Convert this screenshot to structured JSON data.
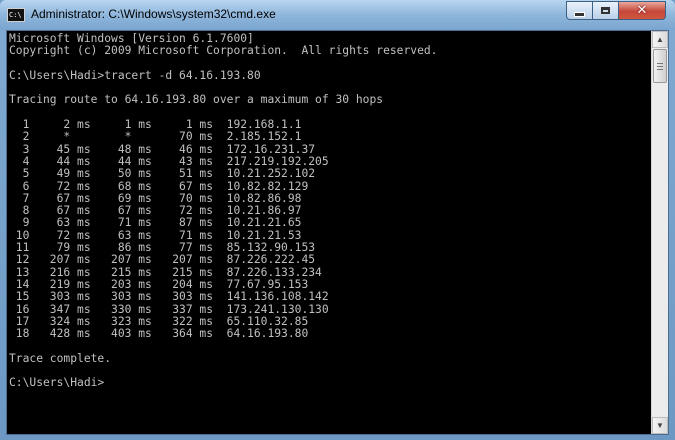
{
  "window": {
    "title": "Administrator: C:\\Windows\\system32\\cmd.exe",
    "icon_label": "C:\\"
  },
  "console": {
    "lines": [
      "Microsoft Windows [Version 6.1.7600]",
      "Copyright (c) 2009 Microsoft Corporation.  All rights reserved.",
      "",
      "C:\\Users\\Hadi>tracert -d 64.16.193.80",
      "",
      "Tracing route to 64.16.193.80 over a maximum of 30 hops",
      "",
      "  1     2 ms     1 ms     1 ms  192.168.1.1",
      "  2     *        *       70 ms  2.185.152.1",
      "  3    45 ms    48 ms    46 ms  172.16.231.37",
      "  4    44 ms    44 ms    43 ms  217.219.192.205",
      "  5    49 ms    50 ms    51 ms  10.21.252.102",
      "  6    72 ms    68 ms    67 ms  10.82.82.129",
      "  7    67 ms    69 ms    70 ms  10.82.86.98",
      "  8    67 ms    67 ms    72 ms  10.21.86.97",
      "  9    63 ms    71 ms    87 ms  10.21.21.65",
      " 10    72 ms    63 ms    71 ms  10.21.21.53",
      " 11    79 ms    86 ms    77 ms  85.132.90.153",
      " 12   207 ms   207 ms   207 ms  87.226.222.45",
      " 13   216 ms   215 ms   215 ms  87.226.133.234",
      " 14   219 ms   203 ms   204 ms  77.67.95.153",
      " 15   303 ms   303 ms   303 ms  141.136.108.142",
      " 16   347 ms   330 ms   337 ms  173.241.130.130",
      " 17   324 ms   323 ms   322 ms  65.110.32.85",
      " 18   428 ms   403 ms   364 ms  64.16.193.80",
      "",
      "Trace complete.",
      "",
      "C:\\Users\\Hadi>"
    ]
  },
  "scrollbar": {
    "up_icon": "scroll-up-arrow",
    "down_icon": "scroll-down-arrow"
  },
  "colors": {
    "console_bg": "#000000",
    "console_text": "#c0c0c0"
  }
}
